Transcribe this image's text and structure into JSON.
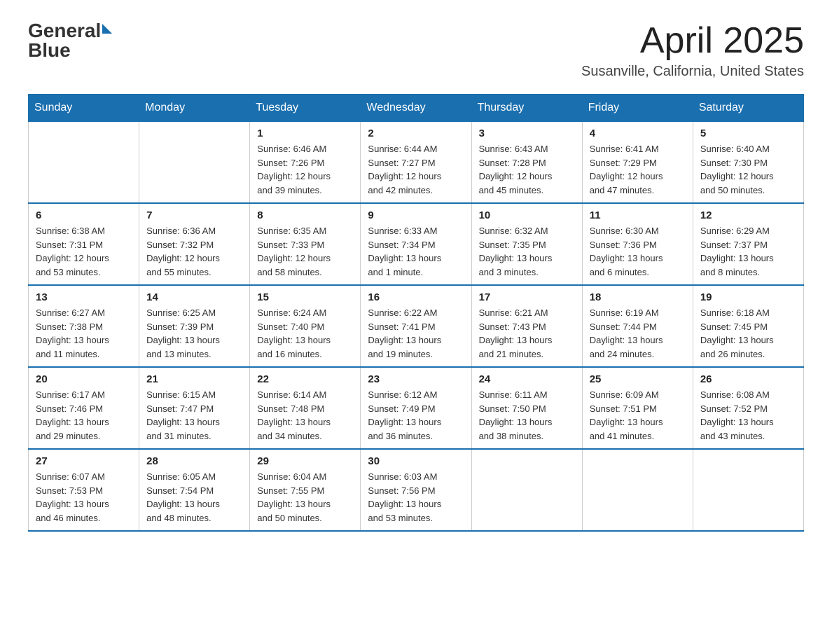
{
  "header": {
    "logo_general": "General",
    "logo_blue": "Blue",
    "title": "April 2025",
    "location": "Susanville, California, United States"
  },
  "calendar": {
    "days_of_week": [
      "Sunday",
      "Monday",
      "Tuesday",
      "Wednesday",
      "Thursday",
      "Friday",
      "Saturday"
    ],
    "weeks": [
      [
        {
          "day": "",
          "info": ""
        },
        {
          "day": "",
          "info": ""
        },
        {
          "day": "1",
          "info": "Sunrise: 6:46 AM\nSunset: 7:26 PM\nDaylight: 12 hours\nand 39 minutes."
        },
        {
          "day": "2",
          "info": "Sunrise: 6:44 AM\nSunset: 7:27 PM\nDaylight: 12 hours\nand 42 minutes."
        },
        {
          "day": "3",
          "info": "Sunrise: 6:43 AM\nSunset: 7:28 PM\nDaylight: 12 hours\nand 45 minutes."
        },
        {
          "day": "4",
          "info": "Sunrise: 6:41 AM\nSunset: 7:29 PM\nDaylight: 12 hours\nand 47 minutes."
        },
        {
          "day": "5",
          "info": "Sunrise: 6:40 AM\nSunset: 7:30 PM\nDaylight: 12 hours\nand 50 minutes."
        }
      ],
      [
        {
          "day": "6",
          "info": "Sunrise: 6:38 AM\nSunset: 7:31 PM\nDaylight: 12 hours\nand 53 minutes."
        },
        {
          "day": "7",
          "info": "Sunrise: 6:36 AM\nSunset: 7:32 PM\nDaylight: 12 hours\nand 55 minutes."
        },
        {
          "day": "8",
          "info": "Sunrise: 6:35 AM\nSunset: 7:33 PM\nDaylight: 12 hours\nand 58 minutes."
        },
        {
          "day": "9",
          "info": "Sunrise: 6:33 AM\nSunset: 7:34 PM\nDaylight: 13 hours\nand 1 minute."
        },
        {
          "day": "10",
          "info": "Sunrise: 6:32 AM\nSunset: 7:35 PM\nDaylight: 13 hours\nand 3 minutes."
        },
        {
          "day": "11",
          "info": "Sunrise: 6:30 AM\nSunset: 7:36 PM\nDaylight: 13 hours\nand 6 minutes."
        },
        {
          "day": "12",
          "info": "Sunrise: 6:29 AM\nSunset: 7:37 PM\nDaylight: 13 hours\nand 8 minutes."
        }
      ],
      [
        {
          "day": "13",
          "info": "Sunrise: 6:27 AM\nSunset: 7:38 PM\nDaylight: 13 hours\nand 11 minutes."
        },
        {
          "day": "14",
          "info": "Sunrise: 6:25 AM\nSunset: 7:39 PM\nDaylight: 13 hours\nand 13 minutes."
        },
        {
          "day": "15",
          "info": "Sunrise: 6:24 AM\nSunset: 7:40 PM\nDaylight: 13 hours\nand 16 minutes."
        },
        {
          "day": "16",
          "info": "Sunrise: 6:22 AM\nSunset: 7:41 PM\nDaylight: 13 hours\nand 19 minutes."
        },
        {
          "day": "17",
          "info": "Sunrise: 6:21 AM\nSunset: 7:43 PM\nDaylight: 13 hours\nand 21 minutes."
        },
        {
          "day": "18",
          "info": "Sunrise: 6:19 AM\nSunset: 7:44 PM\nDaylight: 13 hours\nand 24 minutes."
        },
        {
          "day": "19",
          "info": "Sunrise: 6:18 AM\nSunset: 7:45 PM\nDaylight: 13 hours\nand 26 minutes."
        }
      ],
      [
        {
          "day": "20",
          "info": "Sunrise: 6:17 AM\nSunset: 7:46 PM\nDaylight: 13 hours\nand 29 minutes."
        },
        {
          "day": "21",
          "info": "Sunrise: 6:15 AM\nSunset: 7:47 PM\nDaylight: 13 hours\nand 31 minutes."
        },
        {
          "day": "22",
          "info": "Sunrise: 6:14 AM\nSunset: 7:48 PM\nDaylight: 13 hours\nand 34 minutes."
        },
        {
          "day": "23",
          "info": "Sunrise: 6:12 AM\nSunset: 7:49 PM\nDaylight: 13 hours\nand 36 minutes."
        },
        {
          "day": "24",
          "info": "Sunrise: 6:11 AM\nSunset: 7:50 PM\nDaylight: 13 hours\nand 38 minutes."
        },
        {
          "day": "25",
          "info": "Sunrise: 6:09 AM\nSunset: 7:51 PM\nDaylight: 13 hours\nand 41 minutes."
        },
        {
          "day": "26",
          "info": "Sunrise: 6:08 AM\nSunset: 7:52 PM\nDaylight: 13 hours\nand 43 minutes."
        }
      ],
      [
        {
          "day": "27",
          "info": "Sunrise: 6:07 AM\nSunset: 7:53 PM\nDaylight: 13 hours\nand 46 minutes."
        },
        {
          "day": "28",
          "info": "Sunrise: 6:05 AM\nSunset: 7:54 PM\nDaylight: 13 hours\nand 48 minutes."
        },
        {
          "day": "29",
          "info": "Sunrise: 6:04 AM\nSunset: 7:55 PM\nDaylight: 13 hours\nand 50 minutes."
        },
        {
          "day": "30",
          "info": "Sunrise: 6:03 AM\nSunset: 7:56 PM\nDaylight: 13 hours\nand 53 minutes."
        },
        {
          "day": "",
          "info": ""
        },
        {
          "day": "",
          "info": ""
        },
        {
          "day": "",
          "info": ""
        }
      ]
    ]
  }
}
